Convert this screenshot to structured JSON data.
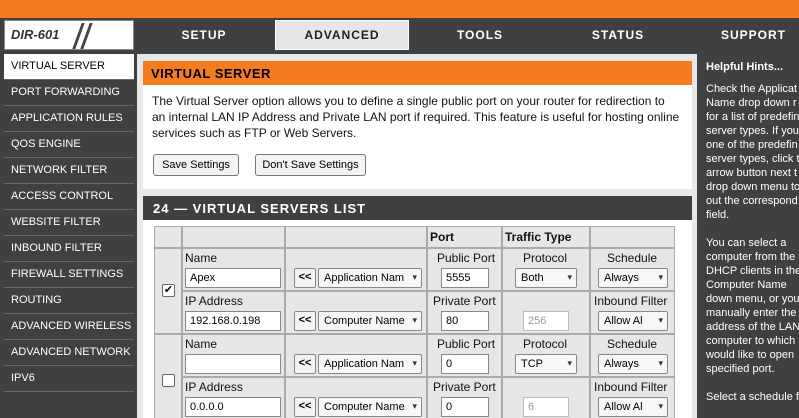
{
  "model": "DIR-601",
  "tabs": [
    {
      "label": "SETUP"
    },
    {
      "label": "ADVANCED"
    },
    {
      "label": "TOOLS"
    },
    {
      "label": "STATUS"
    },
    {
      "label": "SUPPORT"
    }
  ],
  "sidebar": {
    "items": [
      {
        "label": "VIRTUAL SERVER"
      },
      {
        "label": "PORT FORWARDING"
      },
      {
        "label": "APPLICATION RULES"
      },
      {
        "label": "QOS ENGINE"
      },
      {
        "label": "NETWORK FILTER"
      },
      {
        "label": "ACCESS CONTROL"
      },
      {
        "label": "WEBSITE FILTER"
      },
      {
        "label": "INBOUND FILTER"
      },
      {
        "label": "FIREWALL SETTINGS"
      },
      {
        "label": "ROUTING"
      },
      {
        "label": "ADVANCED WIRELESS"
      },
      {
        "label": "ADVANCED NETWORK"
      },
      {
        "label": "IPV6"
      }
    ]
  },
  "virtual_server": {
    "title": "VIRTUAL SERVER",
    "desc_lines": [
      "The Virtual Server option allows you to define a single public port on your router for redirection to",
      "an internal LAN IP Address and Private LAN port if required. This feature is useful for hosting online",
      "services such as FTP or Web Servers."
    ],
    "save_label": "Save Settings",
    "dont_save_label": "Don't Save Settings"
  },
  "list": {
    "title": "24 — VIRTUAL SERVERS LIST",
    "col_port": "Port",
    "col_traffic": "Traffic Type",
    "labels": {
      "name": "Name",
      "ip": "IP Address",
      "public_port": "Public Port",
      "private_port": "Private Port",
      "protocol": "Protocol",
      "schedule": "Schedule",
      "inbound": "Inbound Filter",
      "arrow_btn": "<<"
    },
    "rows": [
      {
        "checked": "✔",
        "name": "Apex",
        "app_select": "Application Nam",
        "public_port": "5555",
        "protocol": "Both",
        "schedule": "Always",
        "ip": "192.168.0.198",
        "computer_select": "Computer Name",
        "private_port": "80",
        "protocol_num": "256",
        "inbound": "Allow Al"
      },
      {
        "checked": "",
        "name": "",
        "app_select": "Application Nam",
        "public_port": "0",
        "protocol": "TCP",
        "schedule": "Always",
        "ip": "0.0.0.0",
        "computer_select": "Computer Name",
        "private_port": "0",
        "protocol_num": "6",
        "inbound": "Allow Al"
      }
    ]
  },
  "hints": {
    "title": "Helpful Hints...",
    "lines": [
      "Check the Applicat",
      "Name drop down r",
      "for a list of predefin",
      "server types. If you",
      "one of the predefin",
      "server types, click t",
      "arrow button next t",
      "drop down menu to",
      "out the correspond",
      "field.",
      "",
      "You can select a",
      "computer from the",
      "DHCP clients in the",
      "Computer Name",
      "down menu, or you",
      "manually enter the",
      "address of the LAN",
      "computer to which",
      "would like to open",
      "specified port.",
      "",
      "Select a schedule f"
    ]
  },
  "colors": {
    "accent": "#f47b1f",
    "dark": "#404040",
    "panel": "#e8e8e8"
  }
}
